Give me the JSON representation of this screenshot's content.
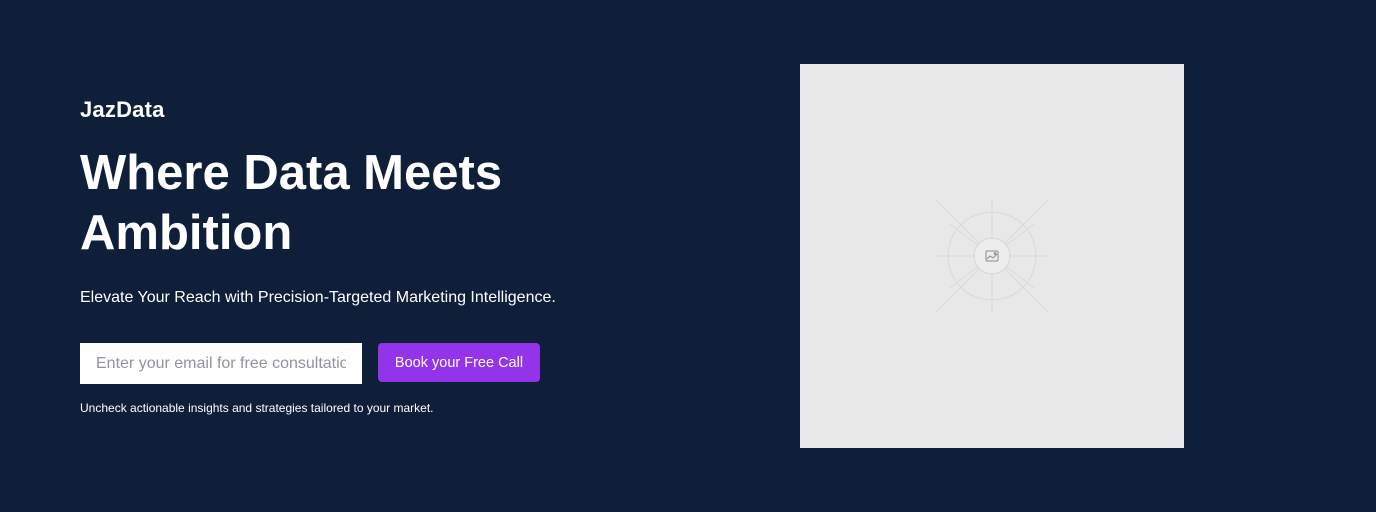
{
  "brand": {
    "name": "JazData"
  },
  "hero": {
    "headline": "Where Data Meets Ambition",
    "subheadline": "Elevate Your Reach with Precision-Targeted Marketing Intelligence.",
    "email_placeholder": "Enter your email for free consultation",
    "cta_label": "Book your Free Call",
    "disclaimer": "Uncheck actionable insights and strategies tailored to your market."
  },
  "media": {
    "icon": "image-icon"
  },
  "colors": {
    "background": "#0f1f3a",
    "accent": "#9333ea",
    "placeholder_bg": "#e8e8e8"
  }
}
